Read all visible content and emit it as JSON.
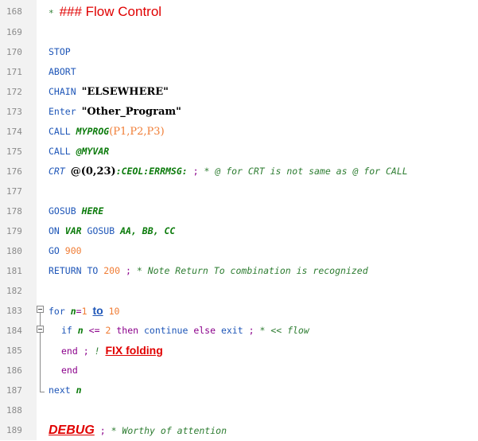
{
  "editor": {
    "lines": [
      {
        "n": "168"
      },
      {
        "n": "169"
      },
      {
        "n": "170"
      },
      {
        "n": "171"
      },
      {
        "n": "172"
      },
      {
        "n": "173"
      },
      {
        "n": "174"
      },
      {
        "n": "175"
      },
      {
        "n": "176"
      },
      {
        "n": "177"
      },
      {
        "n": "178"
      },
      {
        "n": "179"
      },
      {
        "n": "180"
      },
      {
        "n": "181"
      },
      {
        "n": "182"
      },
      {
        "n": "183"
      },
      {
        "n": "184"
      },
      {
        "n": "185"
      },
      {
        "n": "186"
      },
      {
        "n": "187"
      },
      {
        "n": "188"
      },
      {
        "n": "189"
      }
    ],
    "t168": {
      "star": "*",
      "title": "### Flow Control"
    },
    "t170": "STOP",
    "t171": "ABORT",
    "t172": {
      "kw": "CHAIN",
      "str": "\"ELSEWHERE\""
    },
    "t173": {
      "kw": "Enter",
      "str": "\"Other_Program\""
    },
    "t174": {
      "kw": "CALL",
      "fn": "MYPROG",
      "args": "(P1,P2,P3)"
    },
    "t175": {
      "kw": "CALL",
      "var": "@MYVAR"
    },
    "t176": {
      "kw": "CRT",
      "at": "@(0,23)",
      "codes": ":CEOL:ERRMSG:",
      "semi": ";",
      "comment": "* @ for CRT is not same as @ for CALL"
    },
    "t178": {
      "kw": "GOSUB",
      "label": "HERE"
    },
    "t179": {
      "kw": "ON",
      "var": "VAR",
      "kw2": "GOSUB",
      "labels": "AA, BB, CC"
    },
    "t180": {
      "kw": "GO",
      "num": "900"
    },
    "t181": {
      "kw": "RETURN TO",
      "num": "200",
      "semi": ";",
      "comment": "* Note Return To combination is recognized"
    },
    "t183": {
      "kw": "for",
      "var": "n",
      "eq": "=",
      "n1": "1",
      "to": "to",
      "n2": "10"
    },
    "t184": {
      "kw": "if",
      "var": "n",
      "op": "<=",
      "num": "2",
      "then": "then",
      "cont": "continue",
      "els": "else",
      "exit": "exit",
      "semi": ";",
      "comment": "* << flow"
    },
    "t185": {
      "kw": "end",
      "semi": ";",
      "bang": "!",
      "fix": "FIX folding"
    },
    "t186": "end",
    "t187": {
      "kw": "next",
      "var": "n"
    },
    "t189": {
      "debug": "DEBUG",
      "semi": ";",
      "comment": "* Worthy of attention"
    }
  }
}
